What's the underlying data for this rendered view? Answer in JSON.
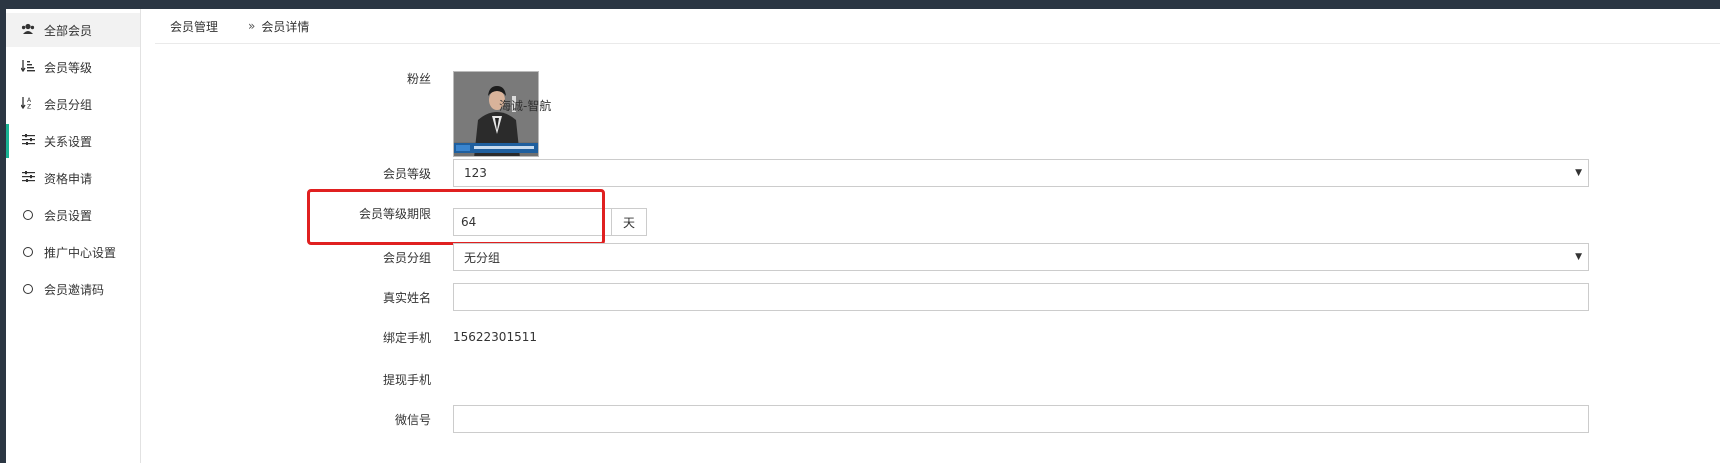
{
  "sidebar": {
    "items": [
      {
        "label": "全部会员",
        "icon": "users-icon",
        "glyph": "👥"
      },
      {
        "label": "会员等级",
        "icon": "sort-amount-icon",
        "glyph": "⇣≡"
      },
      {
        "label": "会员分组",
        "icon": "sort-alpha-icon",
        "glyph": "↓ᴬz"
      },
      {
        "label": "关系设置",
        "icon": "sliders-icon",
        "glyph": "☰"
      },
      {
        "label": "资格申请",
        "icon": "sliders-icon",
        "glyph": "☰"
      },
      {
        "label": "会员设置",
        "icon": "circle-icon"
      },
      {
        "label": "推广中心设置",
        "icon": "circle-icon"
      },
      {
        "label": "会员邀请码",
        "icon": "circle-icon"
      }
    ]
  },
  "breadcrumb": {
    "root": "会员管理",
    "separator": "»",
    "current": "会员详情"
  },
  "form": {
    "fans_label": "粉丝",
    "fans_name": "海诚-智航",
    "level_label": "会员等级",
    "level_value": "123",
    "level_period_label": "会员等级期限",
    "level_period_value": "64",
    "level_period_unit": "天",
    "group_label": "会员分组",
    "group_value": "无分组",
    "realname_label": "真实姓名",
    "realname_value": "",
    "bound_phone_label": "绑定手机",
    "bound_phone_value": "15622301511",
    "withdraw_phone_label": "提现手机",
    "withdraw_phone_value": "",
    "wechat_label": "微信号",
    "wechat_value": ""
  },
  "colors": {
    "topbar": "#2b3643",
    "highlight": "#e02020",
    "active_marker": "#1ab394"
  }
}
